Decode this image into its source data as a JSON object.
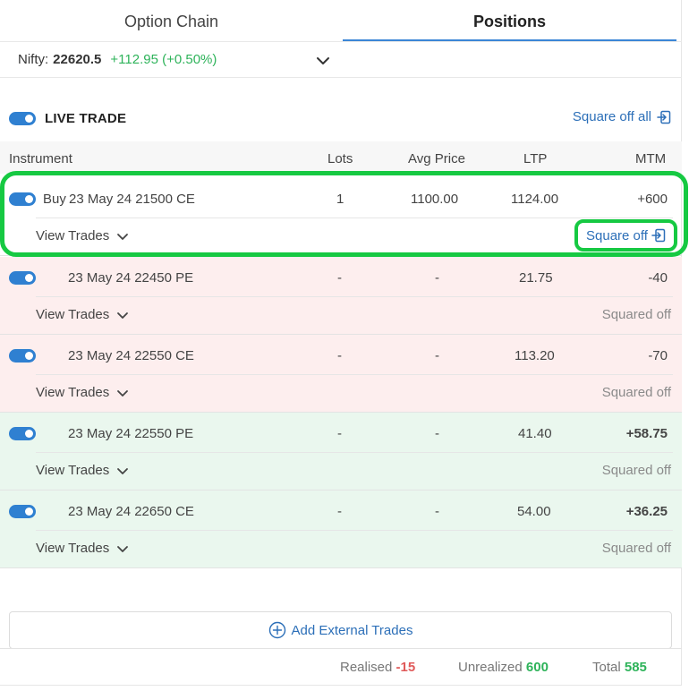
{
  "tabs": [
    {
      "label": "Option Chain",
      "active": false
    },
    {
      "label": "Positions",
      "active": true
    }
  ],
  "index": {
    "label": "Nifty:",
    "value": "22620.5",
    "change": "+112.95 (+0.50%)"
  },
  "live_trade": {
    "label": "LIVE TRADE",
    "enabled": true,
    "square_off_all": "Square off all"
  },
  "columns": [
    "Instrument",
    "Lots",
    "Avg Price",
    "LTP",
    "MTM"
  ],
  "positions": [
    {
      "side": "Buy",
      "instrument": "23 May 24 21500 CE",
      "lots": "1",
      "avg_price": "1100.00",
      "ltp": "1124.00",
      "mtm": "+600",
      "view_trades": "View Trades",
      "action": "Square off",
      "tone": "neutral"
    },
    {
      "side": "",
      "instrument": "23 May 24 22450 PE",
      "lots": "-",
      "avg_price": "-",
      "ltp": "21.75",
      "mtm": "-40",
      "view_trades": "View Trades",
      "action": "Squared off",
      "tone": "red"
    },
    {
      "side": "",
      "instrument": "23 May 24 22550 CE",
      "lots": "-",
      "avg_price": "-",
      "ltp": "113.20",
      "mtm": "-70",
      "view_trades": "View Trades",
      "action": "Squared off",
      "tone": "red"
    },
    {
      "side": "",
      "instrument": "23 May 24 22550 PE",
      "lots": "-",
      "avg_price": "-",
      "ltp": "41.40",
      "mtm": "+58.75",
      "view_trades": "View Trades",
      "action": "Squared off",
      "tone": "green"
    },
    {
      "side": "",
      "instrument": "23 May 24 22650 CE",
      "lots": "-",
      "avg_price": "-",
      "ltp": "54.00",
      "mtm": "+36.25",
      "view_trades": "View Trades",
      "action": "Squared off",
      "tone": "green"
    }
  ],
  "add_external": "Add External Trades",
  "footer": {
    "realised_label": "Realised",
    "realised_value": "-15",
    "unrealized_label": "Unrealized",
    "unrealized_value": "600",
    "total_label": "Total",
    "total_value": "585"
  },
  "colors": {
    "accent": "#2f80d1",
    "profit": "#2eb35a",
    "loss": "#e05a5a",
    "highlight": "#16c942"
  }
}
